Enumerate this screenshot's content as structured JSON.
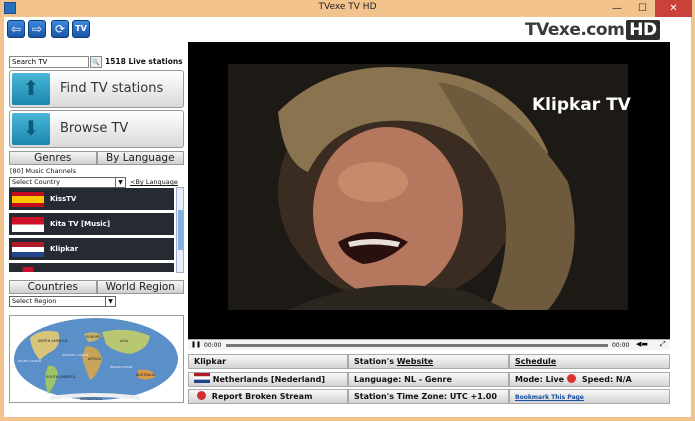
{
  "window": {
    "title": "TVexe TV HD",
    "min_glyph": "—",
    "max_glyph": "☐",
    "close_glyph": "✕"
  },
  "toolbar": {
    "back_glyph": "⇦",
    "forward_glyph": "⇨",
    "refresh_glyph": "⟳",
    "tv_label": "TV",
    "logo_text": "TVexe.com",
    "logo_badge": "HD"
  },
  "search": {
    "value": "Search TV",
    "button_glyph": "🔍",
    "live_count": "1518 Live stations"
  },
  "actions": {
    "find_label": "Find TV stations",
    "browse_label": "Browse TV"
  },
  "tabs_top": [
    "Genres",
    "By Language"
  ],
  "music": {
    "count_label": "[80] Music Channels",
    "country_select": "Select Country",
    "by_language_link": "<By Language"
  },
  "channels": [
    {
      "name": "KissTV",
      "flag": "spain"
    },
    {
      "name": "Kita TV [Music]",
      "flag": "indonesia"
    },
    {
      "name": "Klipkar",
      "flag": "netherlands"
    }
  ],
  "tabs_bottom": [
    "Countries",
    "World Region"
  ],
  "region_select": "Select Region",
  "map_labels": {
    "north_america": "NORTH AMERICA",
    "south_america": "SOUTH AMERICA",
    "europe": "EUROPE",
    "africa": "AFRICA",
    "asia": "ASIA",
    "australia": "AUSTRALIA",
    "antarctica": "ANTARCTICA",
    "atlantic": "ATLANTIC OCEAN",
    "pacific": "PACIFIC OCEAN",
    "indian": "INDIAN OCEAN"
  },
  "video": {
    "watermark": "Klipkar TV",
    "time_current": "00:00",
    "time_total": "00:00"
  },
  "info": {
    "station_name": "Klipkar",
    "website_prefix": "Station's ",
    "website_link": "Website",
    "schedule_link": "Schedule",
    "country": "Netherlands [Nederland]",
    "language": "Language: NL  - Genre",
    "mode_label": "Mode: Live",
    "speed_label": "Speed: N/A",
    "report_label": "Report Broken Stream",
    "timezone": "Station's Time Zone: UTC +1.00",
    "bookmark_link": "Bookmark This Page"
  },
  "colors": {
    "frame": "#f2c38d",
    "close": "#c8423a",
    "accent_blue": "#1b56a8",
    "channel_bg": "#262b33"
  }
}
